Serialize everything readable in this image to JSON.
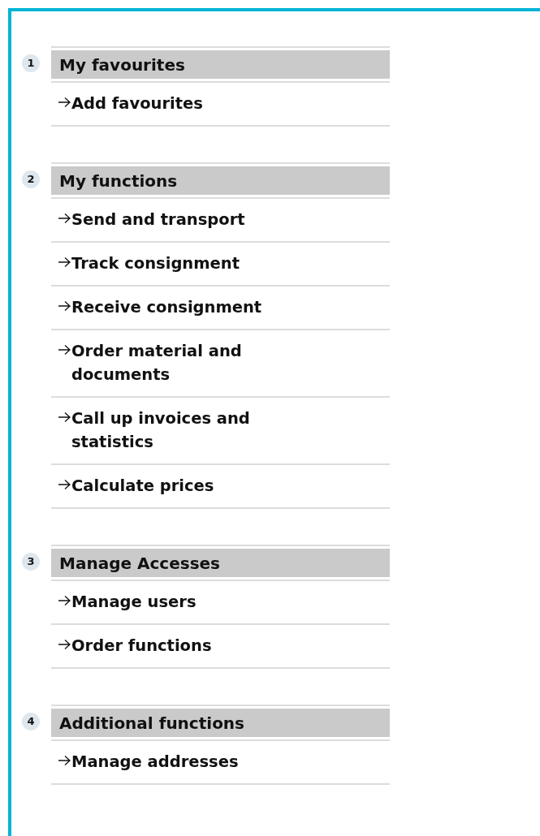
{
  "sections": [
    {
      "number": "1",
      "title": "My favourites",
      "links": [
        "Add favourites"
      ]
    },
    {
      "number": "2",
      "title": "My functions",
      "links": [
        "Send and transport",
        "Track consignment",
        "Receive consignment",
        "Order material and documents",
        "Call up invoices and statistics",
        "Calculate prices"
      ]
    },
    {
      "number": "3",
      "title": "Manage Accesses",
      "links": [
        "Manage users",
        "Order functions"
      ]
    },
    {
      "number": "4",
      "title": "Additional functions",
      "links": [
        "Manage addresses"
      ]
    }
  ]
}
